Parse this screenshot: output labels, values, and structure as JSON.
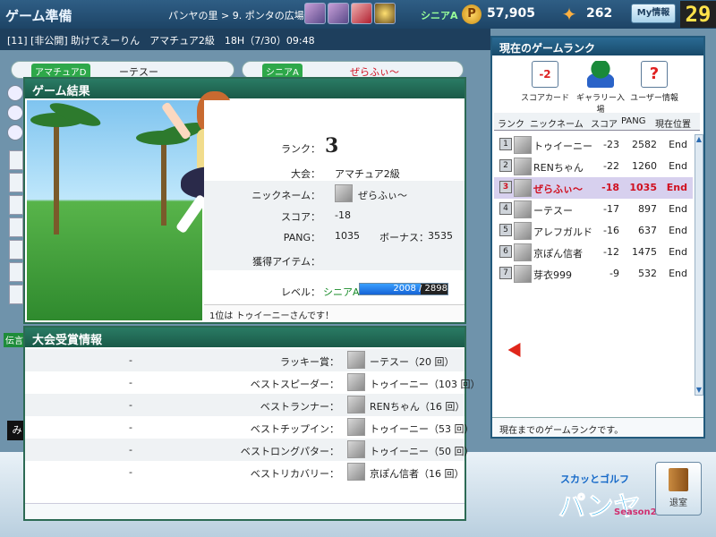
{
  "topbar": {
    "title": "ゲーム準備",
    "breadcrumb": "パンヤの里 > 9. ポンタの広場",
    "rank_label": "シニアA",
    "pang_icon": "P",
    "pang": "57,905",
    "cookie": "262",
    "myinfo_label": "My情報",
    "timer": "29"
  },
  "room": {
    "line": "[11] [非公開] 助けてえーりん　アマチュア2級　18H（7/30）09:48"
  },
  "bg_players": [
    {
      "level": "アマチュアD",
      "name": "ーテスー"
    },
    {
      "level": "シニアA",
      "name": "ぜらふぃ〜"
    }
  ],
  "chat_tag": "伝言",
  "chat_input_stub": "み",
  "rank_panel": {
    "title": "現在のゲームランク",
    "tools": [
      {
        "icon": "score-card-icon",
        "glyph": "-2",
        "label": "スコアカード"
      },
      {
        "icon": "gallery-icon",
        "glyph": "",
        "label": "ギャラリー入場"
      },
      {
        "icon": "user-info-icon",
        "glyph": "?",
        "label": "ユーザー情報"
      }
    ],
    "columns": {
      "rank": "ランク",
      "name": "ニックネーム",
      "score": "スコア",
      "pang": "PANG",
      "pos": "現在位置"
    },
    "rows": [
      {
        "no": "1",
        "name": "トゥイーニー",
        "score": "-23",
        "pang": "2582",
        "pos": "End"
      },
      {
        "no": "2",
        "name": "RENちゃん",
        "score": "-22",
        "pang": "1260",
        "pos": "End"
      },
      {
        "no": "3",
        "name": "ぜらふぃ〜",
        "score": "-18",
        "pang": "1035",
        "pos": "End"
      },
      {
        "no": "4",
        "name": "ーテスー",
        "score": "-17",
        "pang": "897",
        "pos": "End"
      },
      {
        "no": "5",
        "name": "アレフガルド",
        "score": "-16",
        "pang": "637",
        "pos": "End"
      },
      {
        "no": "6",
        "name": "京ぽん信者",
        "score": "-12",
        "pang": "1475",
        "pos": "End"
      },
      {
        "no": "7",
        "name": "芽衣999",
        "score": "-9",
        "pang": "532",
        "pos": "End"
      }
    ],
    "footer": "現在までのゲームランクです。"
  },
  "result": {
    "title": "ゲーム結果",
    "rank_label": "ランク：",
    "rank_value": "3",
    "tournament_label": "大会：",
    "tournament_value": "アマチュア2級",
    "nickname_label": "ニックネーム：",
    "nickname_value": "ぜらふぃ〜",
    "score_label": "スコア：",
    "score_value": "-18",
    "pang_label": "PANG：",
    "pang_value": "1035",
    "bonus_label": "ボーナス：",
    "bonus_value": "3535",
    "items_label": "獲得アイテム：",
    "level_label": "レベル：",
    "level_rank": "シニアA",
    "xp_current": "2008",
    "xp_max": "2898",
    "xp_fraction": 0.693,
    "xp_text": "2008 / 2898",
    "footer": "1位は トゥイーニーさんです！"
  },
  "awards": {
    "title": "大会受賞情報",
    "rows": [
      {
        "dash": "-",
        "title": "ラッキー賞：",
        "who": "ーテスー（20 回）"
      },
      {
        "dash": "-",
        "title": "ベストスピーダー：",
        "who": "トゥイーニー（103 回）"
      },
      {
        "dash": "-",
        "title": "ベストランナー：",
        "who": "RENちゃん（16 回）"
      },
      {
        "dash": "-",
        "title": "ベストチップイン：",
        "who": "トゥイーニー（53 回）"
      },
      {
        "dash": "-",
        "title": "ベストロングパター：",
        "who": "トゥイーニー（50 回）"
      },
      {
        "dash": "-",
        "title": "ベストリカバリー：",
        "who": "京ぽん信者（16 回）"
      }
    ]
  },
  "logo": {
    "line1": "スカッとゴルフ",
    "line2": "パンヤ",
    "line3": "Season2"
  },
  "exit_label": "退室",
  "colors": {
    "highlight_row": "#d7d0ee",
    "self_text": "#d01020",
    "header_green": "#1a5a48",
    "header_blue": "#184a6a"
  }
}
